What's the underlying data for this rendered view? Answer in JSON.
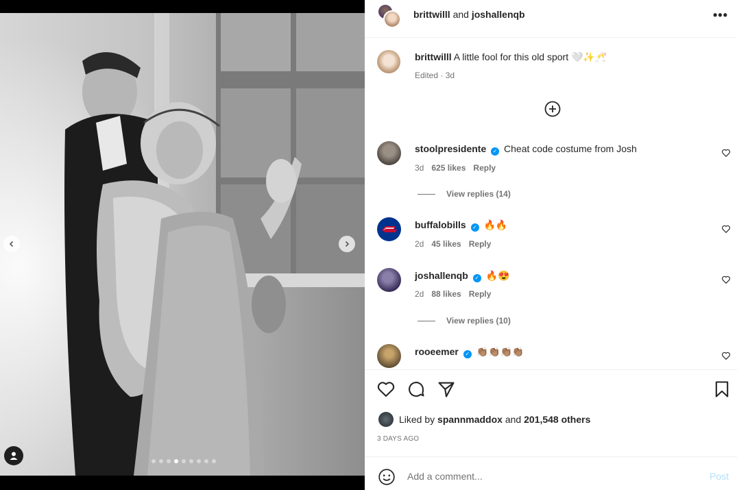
{
  "media": {
    "carousel_dots": 9,
    "active_dot": 3
  },
  "header": {
    "user1": "brittwilll",
    "conjunction": "and",
    "user2": "joshallenqb",
    "more_label": "•••"
  },
  "caption": {
    "username": "brittwilll",
    "text": "A little fool for this old sport 🤍✨🥂",
    "edited": "Edited",
    "separator": "·",
    "time": "3d"
  },
  "comments": [
    {
      "username": "stoolpresidente",
      "verified": true,
      "text": "Cheat code costume from Josh",
      "time": "3d",
      "likes": "625 likes",
      "reply": "Reply",
      "view_replies": "View replies (14)"
    },
    {
      "username": "buffalobills",
      "verified": true,
      "text": "🔥🔥",
      "time": "2d",
      "likes": "45 likes",
      "reply": "Reply"
    },
    {
      "username": "joshallenqb",
      "verified": true,
      "text": "🔥😍",
      "time": "2d",
      "likes": "88 likes",
      "reply": "Reply",
      "view_replies": "View replies (10)"
    },
    {
      "username": "rooeemer",
      "verified": true,
      "text": "👏🏽👏🏽👏🏽👏🏽"
    }
  ],
  "likes": {
    "prefix": "Liked by",
    "user": "spannmaddox",
    "middle": "and",
    "others": "201,548 others"
  },
  "timestamp": "3 DAYS AGO",
  "add_comment": {
    "placeholder": "Add a comment...",
    "post_label": "Post"
  },
  "colors": {
    "verified": "#0095f6",
    "post_disabled": "#b2dffc",
    "muted": "#737373"
  }
}
